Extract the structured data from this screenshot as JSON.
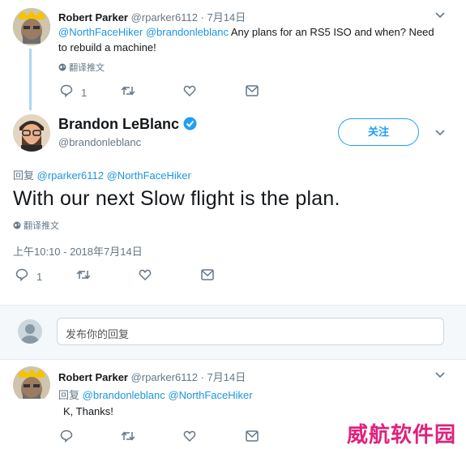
{
  "tweet1": {
    "author_name": "Robert Parker",
    "author_handle": "@rparker6112",
    "date": "· 7月14日",
    "mention1": "@NorthFaceHiker",
    "mention2": "@brandonleblanc",
    "text_line1": "Any plans for an RS5 ISO and when? Need",
    "text_line2": "to rebuild a machine!",
    "translate_label": "翻译推文",
    "reply_count": "1"
  },
  "main_tweet": {
    "author_name": "Brandon LeBlanc",
    "author_handle": "@brandonleblanc",
    "follow_label": "关注",
    "reply_prefix": "回复",
    "reply_to1": "@rparker6112",
    "reply_to2": "@NorthFaceHiker",
    "text": "With our next Slow flight is the plan.",
    "translate_label": "翻译推文",
    "timestamp": "上午10:10 - 2018年7月14日",
    "reply_count": "1"
  },
  "composer": {
    "placeholder": "发布你的回复"
  },
  "tweet3": {
    "author_name": "Robert Parker",
    "author_handle": "@rparker6112",
    "date": "· 7月14日",
    "reply_prefix": "回复",
    "reply_to1": "@brandonleblanc",
    "reply_to2": "@NorthFaceHiker",
    "text": "K, Thanks!"
  },
  "watermark": "威航软件园",
  "colors": {
    "link": "#1b95e0",
    "thread_line": "#aad8f5",
    "verified": "#1da1f2"
  }
}
